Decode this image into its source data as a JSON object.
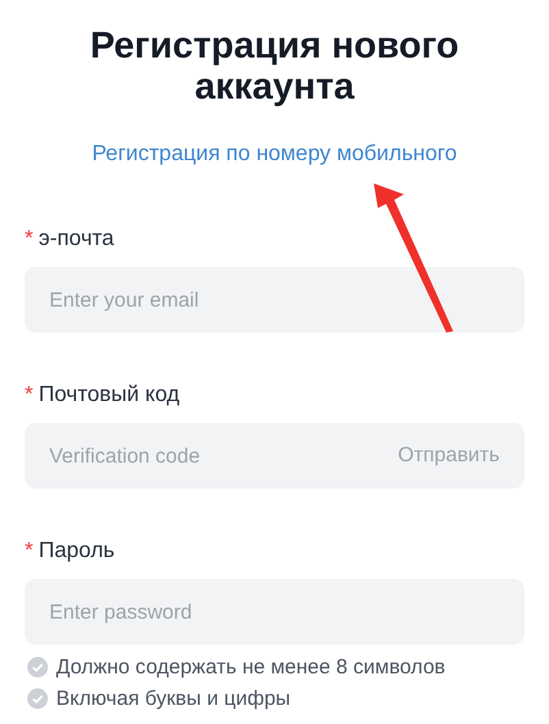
{
  "title": "Регистрация нового аккаунта",
  "switch_link": "Регистрация по номеру мобильного",
  "fields": [
    {
      "label": "э-почта",
      "required_mark": "*",
      "placeholder": "Enter your email"
    },
    {
      "label": "Почтовый код",
      "required_mark": "*",
      "placeholder": "Verification code",
      "action": "Отправить"
    },
    {
      "label": "Пароль",
      "required_mark": "*",
      "placeholder": "Enter password"
    }
  ],
  "requirements": [
    {
      "text": "Должно содержать не менее 8 символов",
      "met": false
    },
    {
      "text": "Включая буквы и цифры",
      "met": false
    }
  ]
}
